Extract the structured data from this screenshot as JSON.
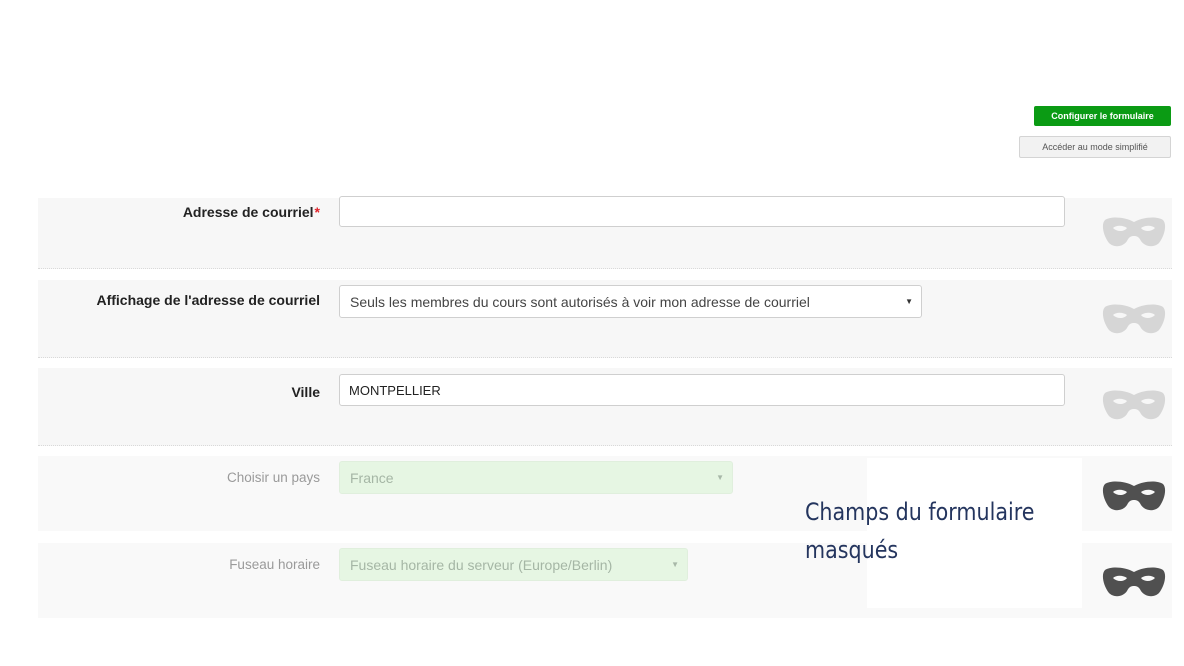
{
  "header": {
    "configure_label": "Configurer le formulaire",
    "simple_mode_label": "Accéder au mode simplifié"
  },
  "fields": {
    "email": {
      "label": "Adresse de courriel",
      "required_mark": "*",
      "value": ""
    },
    "email_display": {
      "label": "Affichage de l'adresse de courriel",
      "selected": "Seuls les membres du cours sont autorisés à voir mon adresse de courriel"
    },
    "city": {
      "label": "Ville",
      "value": "MONTPELLIER"
    },
    "country": {
      "label": "Choisir un pays",
      "selected": "France"
    },
    "timezone": {
      "label": "Fuseau horaire",
      "selected": "Fuseau horaire du serveur (Europe/Berlin)"
    }
  },
  "note": {
    "line1": "Champs du formulaire",
    "line2": "masqués"
  },
  "icons": {
    "visible_mask": "mask-icon-light",
    "hidden_mask": "mask-icon-dark"
  },
  "colors": {
    "accent_green": "#0b9b14",
    "required_red": "#e0242b",
    "mask_light": "#d6d6d6",
    "mask_dark": "#505050",
    "note_text": "#24355e"
  }
}
